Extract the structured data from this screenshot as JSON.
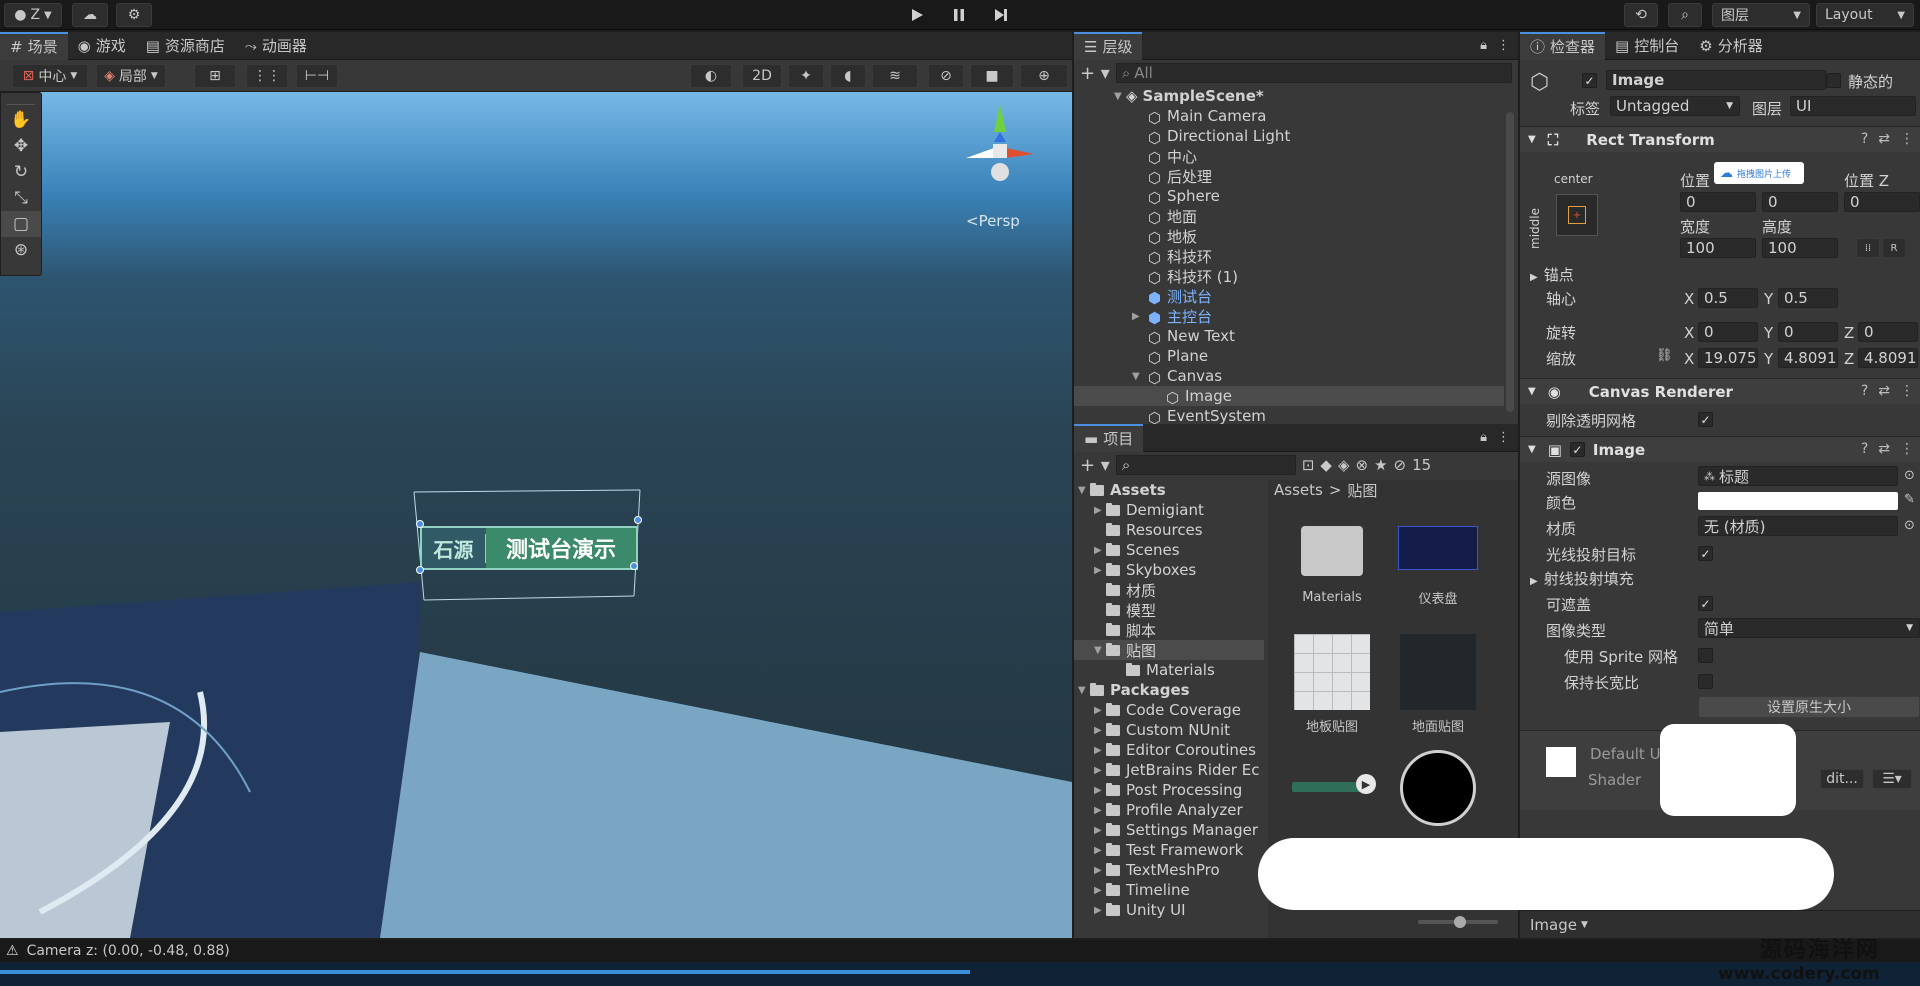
{
  "topbar": {
    "account": "Z",
    "play_icon": "play-icon",
    "pause_icon": "pause-icon",
    "step_icon": "step-icon",
    "layers_label": "图层",
    "layout_label": "Layout"
  },
  "scene_tabs": {
    "scene": "场景",
    "game": "游戏",
    "asset_store": "资源商店",
    "animator": "动画器"
  },
  "scene_toolbar": {
    "pivot": "中心",
    "local": "局部",
    "mode_2d": "2D"
  },
  "scene_view": {
    "persp": "<Persp",
    "status": "Camera z: (0.00, -0.48, 0.88)",
    "sign_left": "石源",
    "sign_text": "测试台演示"
  },
  "hierarchy": {
    "title": "层级",
    "search_placeholder": "All",
    "scene_name": "SampleScene*",
    "items": [
      "Main Camera",
      "Directional Light",
      "中心",
      "后处理",
      "Sphere",
      "地面",
      "地板",
      "科技环",
      "科技环 (1)",
      "测试台",
      "主控台",
      "New Text",
      "Plane",
      "Canvas",
      "Image",
      "EventSystem"
    ]
  },
  "project": {
    "title": "项目",
    "hidden_count": "15",
    "breadcrumb_root": "Assets",
    "breadcrumb_sep": ">",
    "breadcrumb_current": "贴图",
    "tree": [
      "Assets",
      "Demigiant",
      "Resources",
      "Scenes",
      "Skyboxes",
      "材质",
      "模型",
      "脚本",
      "贴图",
      "Materials",
      "Packages",
      "Code Coverage",
      "Custom NUnit",
      "Editor Coroutines",
      "JetBrains Rider Ec",
      "Post Processing",
      "Profile Analyzer",
      "Settings Manager",
      "Test Framework",
      "TextMeshPro",
      "Timeline",
      "Unity UI"
    ],
    "assets": [
      "Materials",
      "仪表盘",
      "地板贴图",
      "地面贴图",
      "",
      ""
    ]
  },
  "inspector": {
    "tabs": {
      "inspector": "检查器",
      "console": "控制台",
      "analyzer": "分析器"
    },
    "object_name": "Image",
    "static_label": "静态的",
    "tag_label": "标签",
    "tag_value": "Untagged",
    "layer_label": "图层",
    "layer_value": "UI",
    "rect": {
      "title": "Rect Transform",
      "anchor_h": "center",
      "anchor_v": "middle",
      "pos_label": "位置",
      "pos_z_label": "位置 Z",
      "pos_x": "0",
      "pos_y": "0",
      "pos_z": "0",
      "width_label": "宽度",
      "height_label": "高度",
      "width": "100",
      "height": "100",
      "anchors_label": "锚点",
      "pivot_label": "轴心",
      "pivot_x": "0.5",
      "pivot_y": "0.5",
      "rotation_label": "旋转",
      "rot_x": "0",
      "rot_y": "0",
      "rot_z": "0",
      "scale_label": "缩放",
      "scale_x": "19.075",
      "scale_y": "4.8091",
      "scale_z": "4.8091",
      "upload_badge": "拖拽图片上传"
    },
    "canvas_renderer": {
      "title": "Canvas Renderer",
      "cull_label": "剔除透明网格"
    },
    "image": {
      "title": "Image",
      "source_label": "源图像",
      "source_value": "标题",
      "color_label": "颜色",
      "material_label": "材质",
      "material_value": "无 (材质)",
      "raycast_label": "光线投射目标",
      "raycast_padding_label": "射线投射填充",
      "maskable_label": "可遮盖",
      "type_label": "图像类型",
      "type_value": "简单",
      "sprite_mesh_label": "使用 Sprite 网格",
      "aspect_label": "保持长宽比",
      "native_size_btn": "设置原生大小"
    },
    "material_preview": {
      "name": "Default U",
      "shader_label": "Shader",
      "edit_label": "dit..."
    },
    "bottom_label": "Image"
  },
  "axes": {
    "x": "X",
    "y": "Y",
    "z": "Z"
  },
  "watermark": {
    "line1": "源码海洋网",
    "line2": "www.codery.com"
  },
  "colors": {
    "accent": "#4a8fe0",
    "panel": "#383838",
    "header": "#282828",
    "sign_green": "#3b8a6a"
  }
}
